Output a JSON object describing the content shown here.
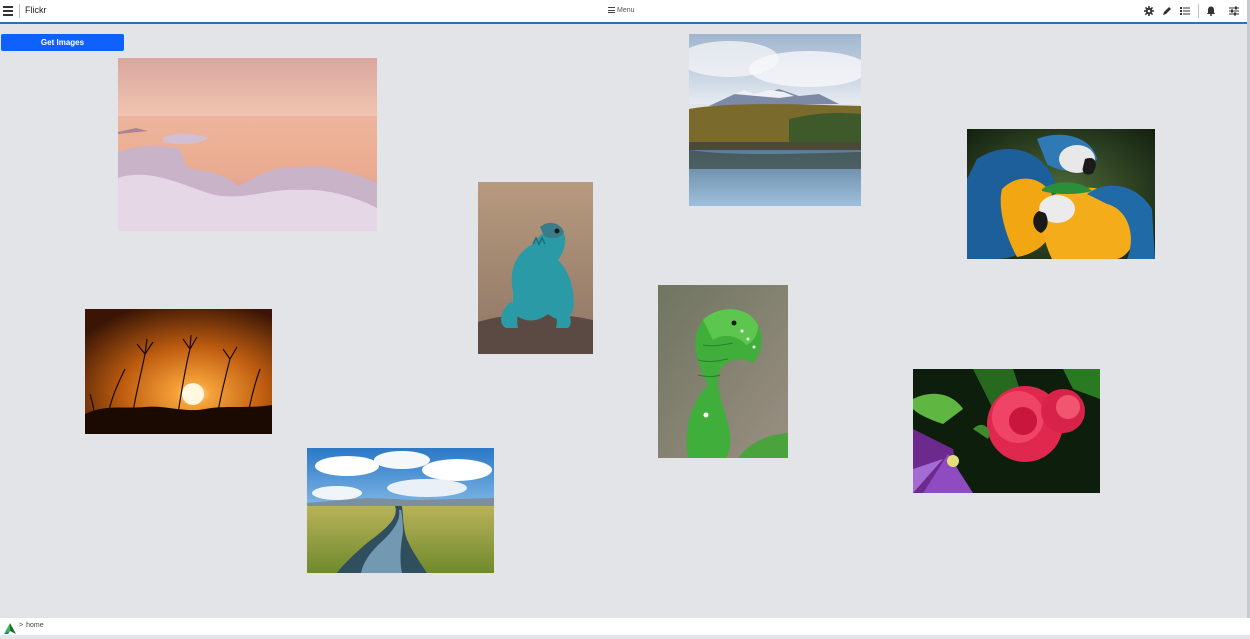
{
  "header": {
    "app_title": "Flickr",
    "menu_label": "Menu",
    "icons": [
      "menu-icon",
      "gear-icon",
      "pencil-icon",
      "list-icon",
      "bell-icon",
      "sliders-icon"
    ]
  },
  "toolbar": {
    "get_images_label": "Get Images",
    "accent_color": "#1060ff"
  },
  "photos": [
    {
      "subject": "pink sunset over frozen sea"
    },
    {
      "subject": "mountain lake with reflection"
    },
    {
      "subject": "blue and yellow macaws"
    },
    {
      "subject": "blue lizard"
    },
    {
      "subject": "sunset through wild grass"
    },
    {
      "subject": "green caterpillar"
    },
    {
      "subject": "pink rose and purple clematis"
    },
    {
      "subject": "stream through grassland under blue sky"
    }
  ],
  "statusbar": {
    "breadcrumb_separator": ">",
    "breadcrumb_current": "home"
  }
}
